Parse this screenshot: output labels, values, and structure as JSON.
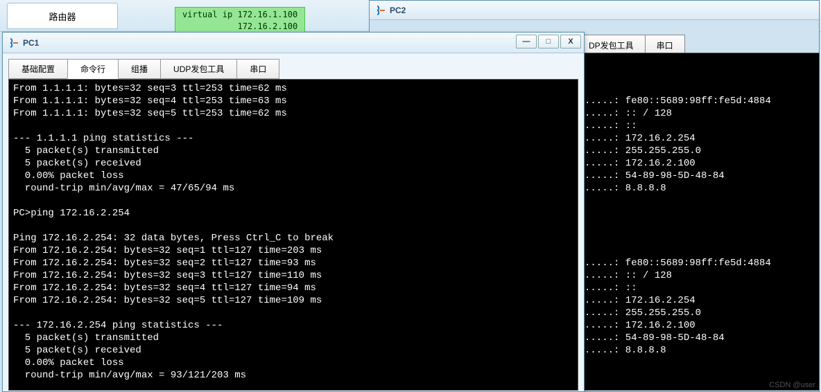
{
  "bg": {
    "router_tab": "路由器",
    "virtual_ip_line1": "virtual ip 172.16.1.100",
    "virtual_ip_line2": "172.16.2.100"
  },
  "pc2": {
    "title": "PC2",
    "tabs": {
      "udp": "DP发包工具",
      "serial": "串口"
    },
    "terminal_output": "\n\n\n.....: fe80::5689:98ff:fe5d:4884\n.....: :: / 128\n.....: ::\n.....: 172.16.2.254\n.....: 255.255.255.0\n.....: 172.16.2.100\n.....: 54-89-98-5D-48-84\n.....: 8.8.8.8\n\n\n\n\n\n.....: fe80::5689:98ff:fe5d:4884\n.....: :: / 128\n.....: ::\n.....: 172.16.2.254\n.....: 255.255.255.0\n.....: 172.16.2.100\n.....: 54-89-98-5D-48-84\n.....: 8.8.8.8\n"
  },
  "pc1": {
    "title": "PC1",
    "win_controls": {
      "min": "—",
      "max": "□",
      "close": "X"
    },
    "tabs": {
      "basic": "基础配置",
      "cli": "命令行",
      "multicast": "组播",
      "udp": "UDP发包工具",
      "serial": "串口"
    },
    "terminal_output": "From 1.1.1.1: bytes=32 seq=3 ttl=253 time=62 ms\nFrom 1.1.1.1: bytes=32 seq=4 ttl=253 time=63 ms\nFrom 1.1.1.1: bytes=32 seq=5 ttl=253 time=62 ms\n\n--- 1.1.1.1 ping statistics ---\n  5 packet(s) transmitted\n  5 packet(s) received\n  0.00% packet loss\n  round-trip min/avg/max = 47/65/94 ms\n\nPC>ping 172.16.2.254\n\nPing 172.16.2.254: 32 data bytes, Press Ctrl_C to break\nFrom 172.16.2.254: bytes=32 seq=1 ttl=127 time=203 ms\nFrom 172.16.2.254: bytes=32 seq=2 ttl=127 time=93 ms\nFrom 172.16.2.254: bytes=32 seq=3 ttl=127 time=110 ms\nFrom 172.16.2.254: bytes=32 seq=4 ttl=127 time=94 ms\nFrom 172.16.2.254: bytes=32 seq=5 ttl=127 time=109 ms\n\n--- 172.16.2.254 ping statistics ---\n  5 packet(s) transmitted\n  5 packet(s) received\n  0.00% packet loss\n  round-trip min/avg/max = 93/121/203 ms"
  },
  "watermark": "CSDN @user"
}
